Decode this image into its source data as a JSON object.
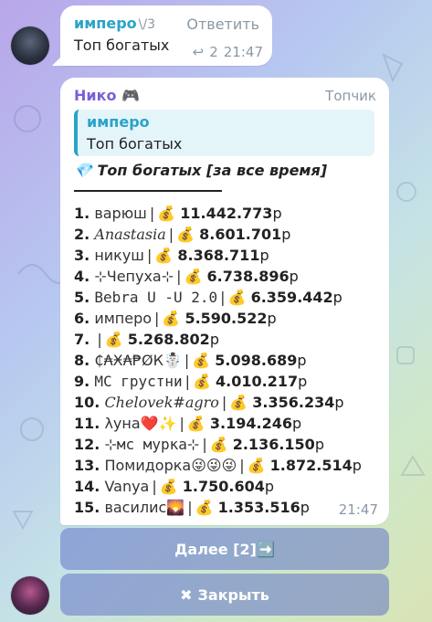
{
  "message1": {
    "sender": "имперо",
    "sender_tag": "\\/3",
    "reply_label": "Ответить",
    "text": "Топ богатых",
    "reply_count": "2",
    "time": "21:47"
  },
  "message2": {
    "sender": "Нико",
    "sender_emoji": "🎮",
    "badge": "Топчик",
    "quote": {
      "sender": "имперо",
      "text": "Топ богатых"
    },
    "heading_icon": "💎",
    "heading": "Топ богатых [за все время]",
    "divider": "——————————",
    "time": "21:47",
    "money_icon": "💰",
    "currency": "р",
    "rows": [
      {
        "num": "1.",
        "name": "варюш",
        "style": "",
        "amount": "11.442.773"
      },
      {
        "num": "2.",
        "name": "Anastasia",
        "style": "script",
        "amount": "8.601.701"
      },
      {
        "num": "3.",
        "name": "никуш",
        "style": "",
        "amount": "8.368.711"
      },
      {
        "num": "4.",
        "name": "⊹Чепуха⊹",
        "style": "",
        "amount": "6.738.896"
      },
      {
        "num": "5.",
        "name": "Bebra U -U 2.0",
        "style": "mono",
        "amount": "6.359.442"
      },
      {
        "num": "6.",
        "name": "имперо",
        "style": "",
        "amount": "5.590.522"
      },
      {
        "num": "7.",
        "name": "",
        "style": "",
        "amount": "5.268.802"
      },
      {
        "num": "8.",
        "name": "₵₳Ӿ₳₱ØК☃️",
        "style": "",
        "amount": "5.098.689"
      },
      {
        "num": "9.",
        "name": "МС грустни",
        "style": "mono",
        "amount": "4.010.217"
      },
      {
        "num": "10.",
        "name": "Chelovek#agro",
        "style": "script",
        "amount": "3.356.234"
      },
      {
        "num": "11.",
        "name": "λуна❤️✨",
        "style": "",
        "amount": "3.194.246"
      },
      {
        "num": "12.",
        "name": "⊹мс мурка⊹",
        "style": "mono",
        "amount": "2.136.150"
      },
      {
        "num": "13.",
        "name": "Помидорка😜😜😜",
        "style": "",
        "amount": "1.872.514"
      },
      {
        "num": "14.",
        "name": "Vanya",
        "style": "",
        "amount": "1.750.604"
      },
      {
        "num": "15.",
        "name": "василис🌄",
        "style": "",
        "amount": "1.353.516"
      }
    ]
  },
  "buttons": {
    "next_label": "Далее [2]➡️",
    "close_icon": "✖",
    "close_label": "Закрыть"
  }
}
